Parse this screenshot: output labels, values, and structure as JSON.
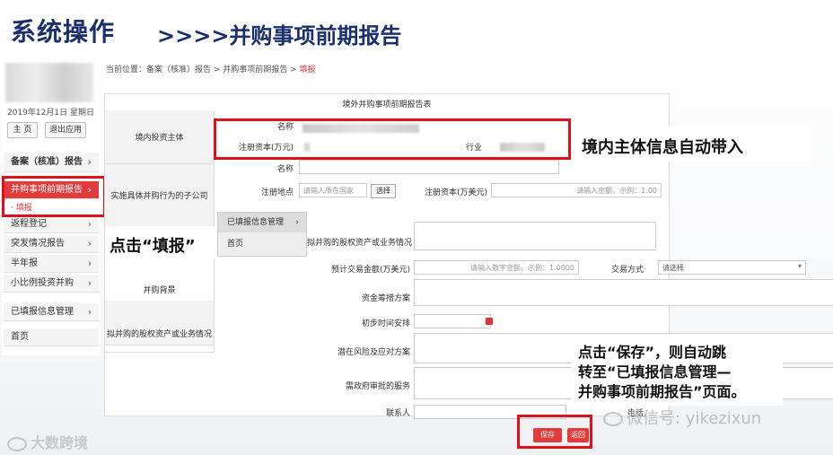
{
  "slide": {
    "title": "系统操作",
    "subtitle": ">>>>并购事项前期报告"
  },
  "sidebar": {
    "date": "2019年12月1日 星期日",
    "home_button": "主 页",
    "logout_button": "退出应用",
    "items": [
      {
        "label": "备案（核准）报告",
        "chevron": "›"
      },
      {
        "label": "并购事项前期报告",
        "chevron": "›"
      },
      {
        "label": "返程登记",
        "chevron": "›"
      },
      {
        "label": "突发情况报告",
        "chevron": "›"
      },
      {
        "label": "半年报",
        "chevron": "›"
      },
      {
        "label": "小比例投资并购",
        "chevron": "›"
      },
      {
        "label": "已填报信息管理",
        "chevron": "›"
      },
      {
        "label": "首页",
        "chevron": ""
      }
    ],
    "sub_item": "· 填报"
  },
  "breadcrumb": {
    "prefix": "当前位置：",
    "path": "备案（核准）报告 > 并购事项前期报告 > ",
    "current": "填报"
  },
  "form": {
    "title": "境外并购事项前期报告表",
    "sections": {
      "domestic_investor": "境内投资主体",
      "acquiring_company": "实施具体并购行为的子公司",
      "acquisition_background": "并购背景",
      "target_info": "拟并购的股权资产或业务情况"
    },
    "labels": {
      "name": "名称",
      "registered_capital": "注册资本(万元)",
      "industry": "行业",
      "name2": "名称",
      "registered_place": "注册地点",
      "registered_capital2": "注册资本(万美元)",
      "target_assets": "拟并购的股权资产或业务情况",
      "estimated_price": "预计交易金额(万美元)",
      "trade_method": "交易方式",
      "financing_plan": "资金筹措方案",
      "schedule": "初步时间安排",
      "risk": "潜在风险及应对方案",
      "approvals": "需政府审批的服务",
      "contact": "联系人",
      "phone": "电话"
    },
    "placeholders": {
      "registered_place": "请输入所在国家",
      "registered_capital2": "请输入金额，示例：1.00",
      "estimated_price": "请输入数字金额，示例：1.0000",
      "trade_method": "请选择"
    },
    "select_button": "选择",
    "save_button": "保存",
    "back_button": "返回"
  },
  "flyout": {
    "items": [
      {
        "label": "已填报信息管理",
        "chevron": "›"
      },
      {
        "label": "首页",
        "chevron": ""
      }
    ]
  },
  "callouts": {
    "auto_fill": "境内主体信息自动带入",
    "click_fill": "点击“填报”",
    "save_note_line1": "点击“保存”，则自动跳",
    "save_note_line2": "转至“已填报信息管理—",
    "save_note_line3": "并购事项前期报告”页面。"
  },
  "watermarks": {
    "left": "大数跨境",
    "right": "微信号: yikezixun"
  },
  "colors": {
    "accent_red": "#e23b3b",
    "title_blue": "#1a2f6b",
    "highlight_box": "#e0101a"
  }
}
